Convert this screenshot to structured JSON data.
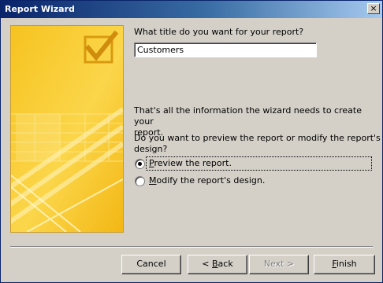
{
  "window": {
    "title": "Report Wizard",
    "close_glyph": "×"
  },
  "colors": {
    "titlebar_start": "#0a246a",
    "titlebar_end": "#a6caf0",
    "dialog_bg": "#d4d0c8",
    "art_yellow": "#f6c320"
  },
  "art": {
    "icon": "report-wizard-checkmark-art"
  },
  "question_label": "What title do you want for your report?",
  "report_title_value": "Customers",
  "info_text_line1": "That's all the information the wizard needs to create your",
  "info_text_line2": "report.",
  "preview_question_line1": "Do you want to preview the report or modify the report's",
  "preview_question_line2": "design?",
  "options": [
    {
      "label_mnemonic": "P",
      "label_rest": "review the report.",
      "selected": true
    },
    {
      "label_mnemonic": "M",
      "label_rest": "odify the report's design.",
      "selected": false
    }
  ],
  "buttons": {
    "cancel": "Cancel",
    "back_prefix": "< ",
    "back_mnemonic": "B",
    "back_rest": "ack",
    "next": "Next >",
    "finish_mnemonic": "F",
    "finish_rest": "inish"
  }
}
